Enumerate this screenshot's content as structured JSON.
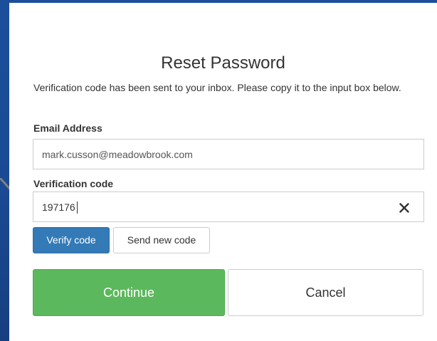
{
  "form": {
    "title": "Reset Password",
    "info_message": "Verification code has been sent to your inbox. Please copy it to the input box below.",
    "email": {
      "label": "Email Address",
      "value": "mark.cusson@meadowbrook.com"
    },
    "verification": {
      "label": "Verification code",
      "value": "197176",
      "clear_icon": "close-icon"
    },
    "buttons": {
      "verify": "Verify code",
      "send_new": "Send new code",
      "continue": "Continue",
      "cancel": "Cancel"
    }
  },
  "colors": {
    "background": "#1b4f9c",
    "primary": "#337ab7",
    "success": "#5cb85c",
    "arrow": "#808080"
  }
}
